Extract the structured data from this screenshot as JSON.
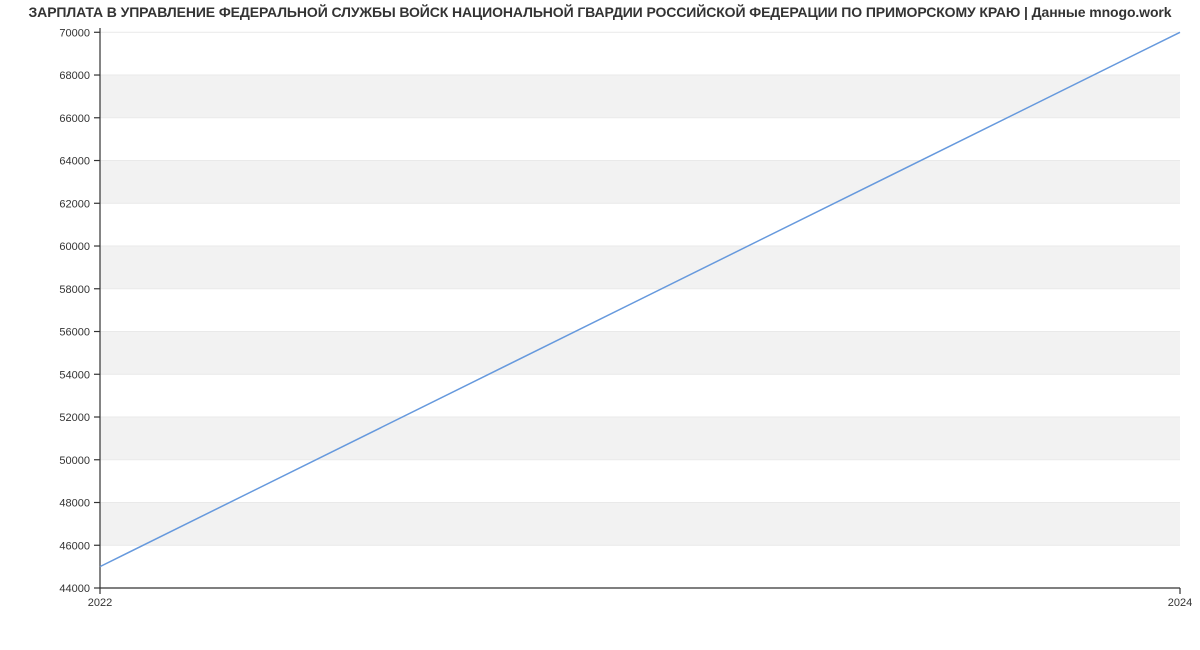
{
  "chart_data": {
    "type": "line",
    "title": "ЗАРПЛАТА В УПРАВЛЕНИЕ ФЕДЕРАЛЬНОЙ СЛУЖБЫ ВОЙСК НАЦИОНАЛЬНОЙ ГВАРДИИ РОССИЙСКОЙ ФЕДЕРАЦИИ ПО ПРИМОРСКОМУ КРАЮ | Данные mnogo.work",
    "xlabel": "",
    "ylabel": "",
    "x": [
      2022,
      2024
    ],
    "series": [
      {
        "name": "salary",
        "values": [
          45000,
          70000
        ],
        "color": "#6699dd"
      }
    ],
    "x_ticks": [
      2022,
      2024
    ],
    "y_ticks": [
      44000,
      46000,
      48000,
      50000,
      52000,
      54000,
      56000,
      58000,
      60000,
      62000,
      64000,
      66000,
      68000,
      70000
    ],
    "xlim": [
      2022,
      2024
    ],
    "ylim": [
      44000,
      70200
    ],
    "grid": true,
    "legend": false
  }
}
